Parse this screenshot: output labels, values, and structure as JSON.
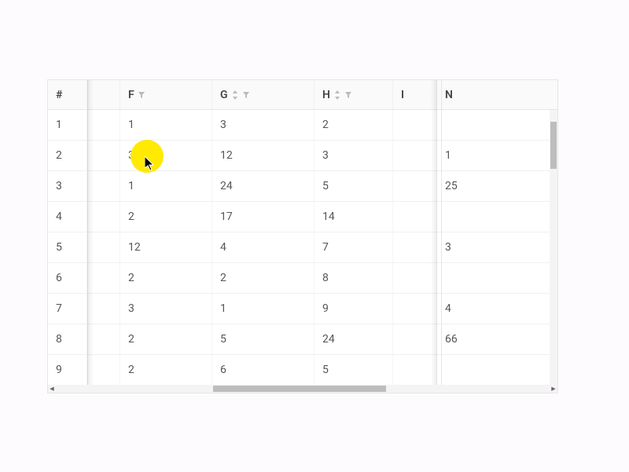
{
  "columns": {
    "idx_header": "#",
    "f": "F",
    "g": "G",
    "h": "H",
    "i": "I",
    "n": "N"
  },
  "rows": [
    {
      "idx": "1",
      "f": "1",
      "g": "3",
      "h": "2",
      "i": "",
      "n": ""
    },
    {
      "idx": "2",
      "f": "3",
      "g": "12",
      "h": "3",
      "i": "",
      "n": "1"
    },
    {
      "idx": "3",
      "f": "1",
      "g": "24",
      "h": "5",
      "i": "",
      "n": "25"
    },
    {
      "idx": "4",
      "f": "2",
      "g": "17",
      "h": "14",
      "i": "",
      "n": ""
    },
    {
      "idx": "5",
      "f": "12",
      "g": "4",
      "h": "7",
      "i": "",
      "n": "3"
    },
    {
      "idx": "6",
      "f": "2",
      "g": "2",
      "h": "8",
      "i": "",
      "n": ""
    },
    {
      "idx": "7",
      "f": "3",
      "g": "1",
      "h": "9",
      "i": "",
      "n": "4"
    },
    {
      "idx": "8",
      "f": "2",
      "g": "5",
      "h": "24",
      "i": "",
      "n": "66"
    },
    {
      "idx": "9",
      "f": "2",
      "g": "6",
      "h": "5",
      "i": "",
      "n": ""
    }
  ],
  "colors": {
    "highlight": "#ffea00",
    "border": "#e6e6e6",
    "text": "#555555",
    "header_bg": "#fafafa",
    "scroll_thumb": "#bdbdbd"
  }
}
